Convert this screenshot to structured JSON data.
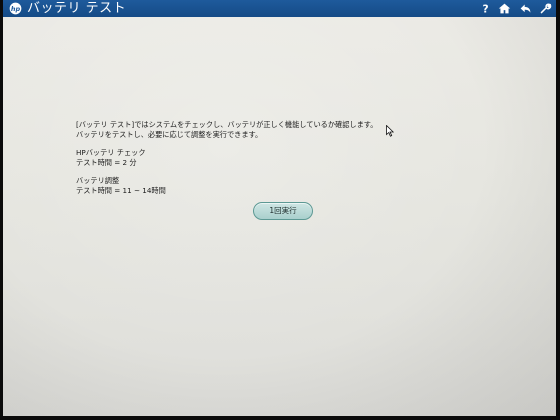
{
  "window": {
    "title": "バッテリ テスト"
  },
  "titlebar_icons": [
    "help-icon",
    "home-icon",
    "back-icon",
    "settings-icon"
  ],
  "description": {
    "line1": "[バッテリ テスト]ではシステムをチェックし、バッテリが正しく機能しているか確認します。",
    "line2": "バッテリをテストし、必要に応じて調整を実行できます。"
  },
  "hp_check": {
    "heading": "HPバッテリ チェック",
    "time": "テスト時間 = 2 分"
  },
  "calibration": {
    "heading": "バッテリ調整",
    "time": "テスト時間 = 11 ~ 14時間"
  },
  "actions": {
    "run_once_label": "1回実行"
  },
  "colors": {
    "titlebar": "#1e5a9c",
    "background": "#e6e6e0",
    "button": "#a9d0cd"
  }
}
